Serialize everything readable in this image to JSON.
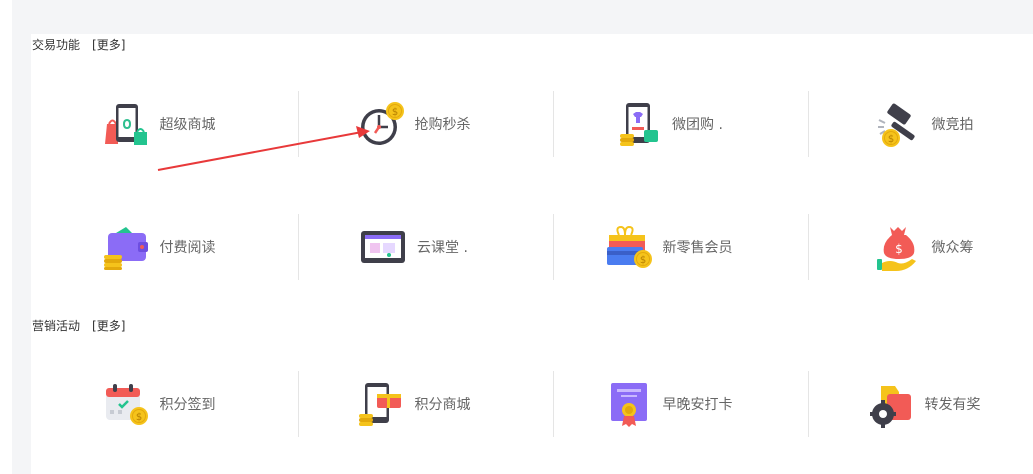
{
  "sections": {
    "trade": {
      "title": "交易功能",
      "more": "[更多]",
      "items": [
        {
          "label": "超级商城",
          "icon": "shopping-phone-icon"
        },
        {
          "label": "抢购秒杀",
          "icon": "clock-coin-icon"
        },
        {
          "label": "微团购 .",
          "icon": "phone-shirt-icon"
        },
        {
          "label": "微竞拍",
          "icon": "auction-hammer-icon"
        },
        {
          "label": "付费阅读",
          "icon": "wallet-icon"
        },
        {
          "label": "云课堂 .",
          "icon": "monitor-icon"
        },
        {
          "label": "新零售会员",
          "icon": "gift-card-icon"
        },
        {
          "label": "微众筹",
          "icon": "money-bag-hand-icon"
        }
      ]
    },
    "marketing": {
      "title": "营销活动",
      "more": "[更多]",
      "items": [
        {
          "label": "积分签到",
          "icon": "calendar-coin-icon"
        },
        {
          "label": "积分商城",
          "icon": "phone-gift-icon"
        },
        {
          "label": "早晚安打卡",
          "icon": "certificate-icon"
        },
        {
          "label": "转发有奖",
          "icon": "gear-box-icon"
        }
      ]
    }
  },
  "colors": {
    "label": "#666666",
    "title": "#333333",
    "separator": "#e5e5e5",
    "arrow": "#e8393a",
    "coin": "#f5c31b",
    "purple": "#8b6cf6",
    "red": "#f25b56",
    "dark": "#3f3f4a"
  }
}
